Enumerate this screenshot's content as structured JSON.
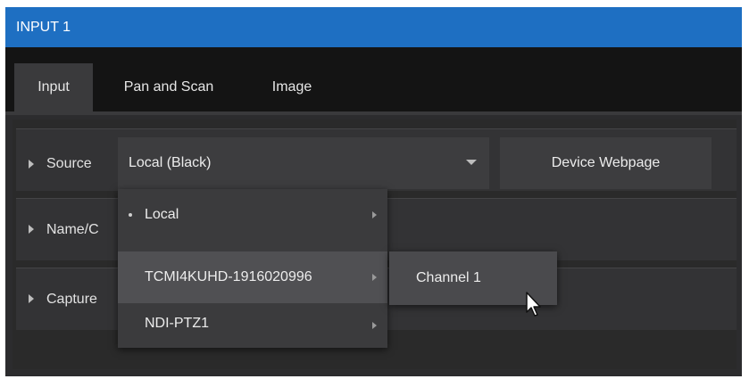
{
  "window": {
    "title": "INPUT 1"
  },
  "tabs": [
    {
      "label": "Input",
      "active": true
    },
    {
      "label": "Pan and Scan",
      "active": false
    },
    {
      "label": "Image",
      "active": false
    }
  ],
  "rows": {
    "source_label": "Source",
    "name_label": "Name/C",
    "capture_label": "Capture"
  },
  "source": {
    "selected_value": "Local (Black)",
    "device_button_label": "Device Webpage"
  },
  "menu": {
    "items": [
      {
        "label": "Local",
        "selected": true,
        "has_submenu": true
      },
      {
        "label": "TCMI4KUHD-1916020996",
        "hovered": true,
        "has_submenu": true
      },
      {
        "label": "NDI-PTZ1",
        "has_submenu": true
      }
    ],
    "submenu": {
      "items": [
        {
          "label": "Channel 1"
        }
      ]
    }
  },
  "colors": {
    "titlebar": "#1e6fc2",
    "background": "#2c2c2e",
    "tab_active": "#3a3a3c",
    "menu": "#3b3b3d"
  },
  "icons": [
    "expand-arrow-icon",
    "dropdown-caret-icon",
    "submenu-arrow-icon",
    "mouse-pointer-icon"
  ]
}
